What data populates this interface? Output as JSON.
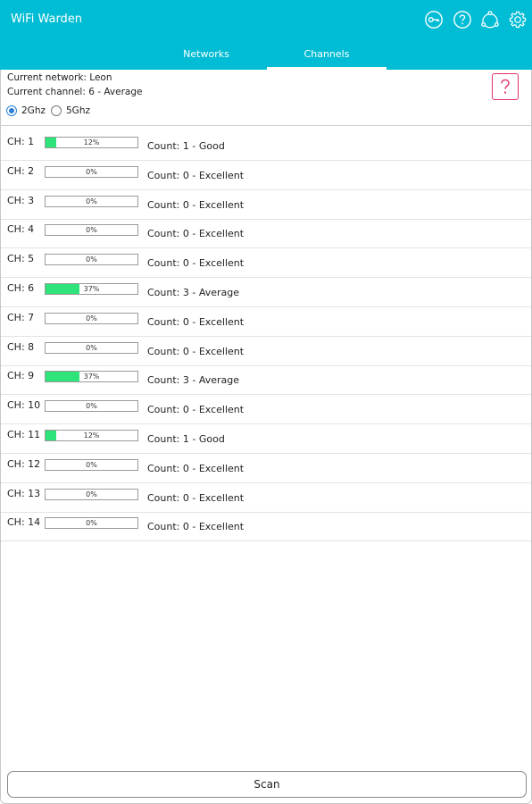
{
  "app": {
    "title": "WiFi Warden"
  },
  "toolbar_icons": [
    "key-icon",
    "help-circle-icon",
    "share-icon",
    "settings-gear-icon"
  ],
  "tabs": [
    {
      "label": "Networks",
      "active": false
    },
    {
      "label": "Channels",
      "active": true
    }
  ],
  "info": {
    "network_line": "Current network: Leon",
    "channel_line": "Current channel: 6 - Average",
    "bands": [
      {
        "label": "2Ghz",
        "checked": true
      },
      {
        "label": "5Ghz",
        "checked": false
      }
    ],
    "help_icon": "question-icon"
  },
  "channels": [
    {
      "label": "CH: 1",
      "percent": 12,
      "percent_text": "12%",
      "count_text": "Count: 1 - Good"
    },
    {
      "label": "CH: 2",
      "percent": 0,
      "percent_text": "0%",
      "count_text": "Count: 0 - Excellent"
    },
    {
      "label": "CH: 3",
      "percent": 0,
      "percent_text": "0%",
      "count_text": "Count: 0 - Excellent"
    },
    {
      "label": "CH: 4",
      "percent": 0,
      "percent_text": "0%",
      "count_text": "Count: 0 - Excellent"
    },
    {
      "label": "CH: 5",
      "percent": 0,
      "percent_text": "0%",
      "count_text": "Count: 0 - Excellent"
    },
    {
      "label": "CH: 6",
      "percent": 37,
      "percent_text": "37%",
      "count_text": "Count: 3 - Average"
    },
    {
      "label": "CH: 7",
      "percent": 0,
      "percent_text": "0%",
      "count_text": "Count: 0 - Excellent"
    },
    {
      "label": "CH: 8",
      "percent": 0,
      "percent_text": "0%",
      "count_text": "Count: 0 - Excellent"
    },
    {
      "label": "CH: 9",
      "percent": 37,
      "percent_text": "37%",
      "count_text": "Count: 3 - Average"
    },
    {
      "label": "CH: 10",
      "percent": 0,
      "percent_text": "0%",
      "count_text": "Count: 0 - Excellent"
    },
    {
      "label": "CH: 11",
      "percent": 12,
      "percent_text": "12%",
      "count_text": "Count: 1 - Good"
    },
    {
      "label": "CH: 12",
      "percent": 0,
      "percent_text": "0%",
      "count_text": "Count: 0 - Excellent"
    },
    {
      "label": "CH: 13",
      "percent": 0,
      "percent_text": "0%",
      "count_text": "Count: 0 - Excellent"
    },
    {
      "label": "CH: 14",
      "percent": 0,
      "percent_text": "0%",
      "count_text": "Count: 0 - Excellent"
    }
  ],
  "scan_label": "Scan",
  "colors": {
    "app_bar": "#00bcd4",
    "bar_fill": "#2ee37a",
    "help_accent": "#e0306a",
    "radio_accent": "#2a7fd4"
  }
}
